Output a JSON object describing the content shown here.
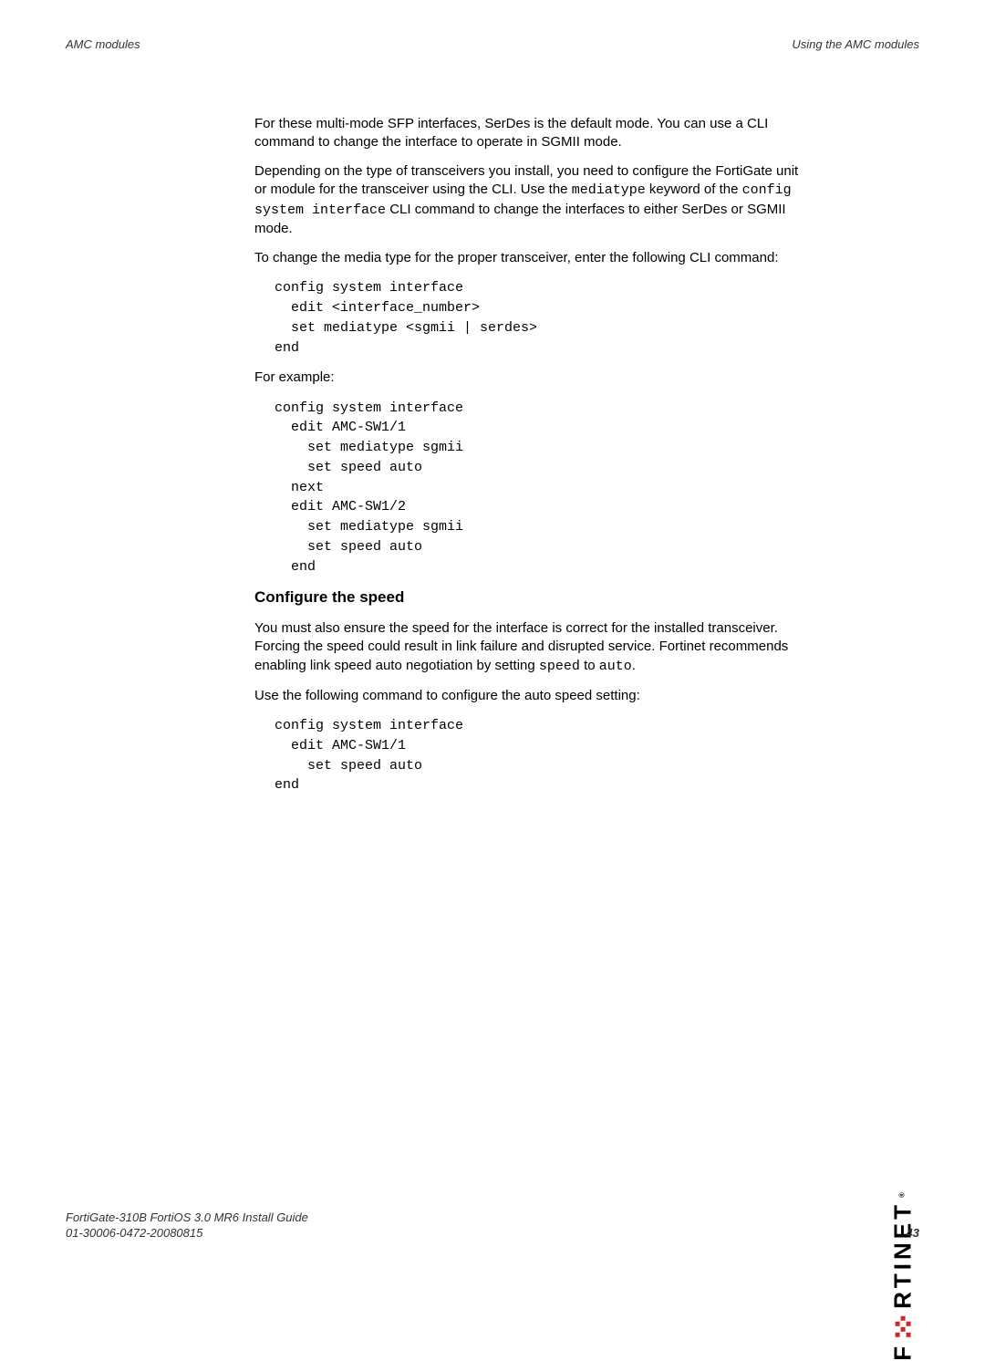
{
  "header": {
    "left": "AMC modules",
    "right": "Using the AMC modules"
  },
  "body": {
    "p1": "For these multi-mode SFP interfaces, SerDes is the default mode. You can use a CLI command to change the interface to operate in SGMII mode.",
    "p2a": "Depending on the type of transceivers you install, you need to configure the FortiGate unit or module for the transceiver using the CLI. Use the ",
    "p2m1": "mediatype",
    "p2b": " keyword of the ",
    "p2m2": "config system interface",
    "p2c": " CLI command to change the interfaces to either SerDes or SGMII mode.",
    "p3": "To change the media type for the proper transceiver, enter the following CLI command:",
    "code1": "config system interface\n  edit <interface_number>\n  set mediatype <sgmii | serdes>\nend",
    "p4": "For example:",
    "code2": "config system interface\n  edit AMC-SW1/1\n    set mediatype sgmii\n    set speed auto\n  next\n  edit AMC-SW1/2\n    set mediatype sgmii\n    set speed auto\n  end",
    "h2": "Configure the speed",
    "p5a": "You must also ensure the speed for the interface is correct for the installed transceiver. Forcing the speed could result in link failure and disrupted service. Fortinet recommends enabling link speed auto negotiation by setting ",
    "p5m1": "speed",
    "p5b": " to ",
    "p5m2": "auto",
    "p5c": ".",
    "p6": "Use the following command to configure the auto speed setting:",
    "code3": "config system interface\n  edit AMC-SW1/1\n    set speed auto\nend"
  },
  "footer": {
    "line1": "FortiGate-310B FortiOS 3.0 MR6 Install Guide",
    "line2": "01-30006-0472-20080815",
    "page": "43"
  },
  "brand": "RTINET",
  "brand_prefix": "F"
}
